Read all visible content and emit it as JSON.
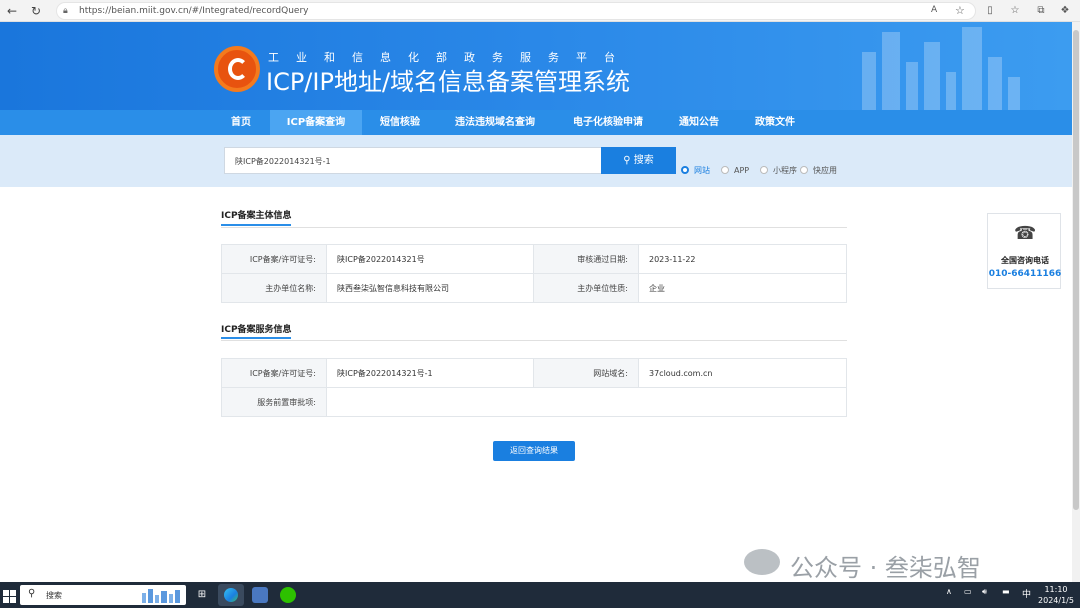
{
  "browser": {
    "url": "https://beian.miit.gov.cn/#/Integrated/recordQuery"
  },
  "header": {
    "gov_title": "工业和信息化部政务服务平台",
    "system_title": "ICP/IP地址/域名信息备案管理系统"
  },
  "nav": {
    "items": [
      "首页",
      "ICP备案查询",
      "短信核验",
      "违法违规域名查询",
      "电子化核验申请",
      "通知公告",
      "政策文件"
    ],
    "active_index": 1
  },
  "search": {
    "value": "陕ICP备2022014321号-1",
    "button_label": "搜索",
    "types": [
      "网站",
      "APP",
      "小程序",
      "快应用"
    ],
    "selected_type": "网站"
  },
  "subject_section": {
    "title": "ICP备案主体信息",
    "rows": [
      {
        "label1": "ICP备案/许可证号:",
        "value1": "陕ICP备2022014321号",
        "label2": "审核通过日期:",
        "value2": "2023-11-22"
      },
      {
        "label1": "主办单位名称:",
        "value1": "陕西叁柒弘智信息科技有限公司",
        "label2": "主办单位性质:",
        "value2": "企业"
      }
    ]
  },
  "service_section": {
    "title": "ICP备案服务信息",
    "row1": {
      "label1": "ICP备案/许可证号:",
      "value1": "陕ICP备2022014321号-1",
      "label2": "网站域名:",
      "value2": "37cloud.com.cn"
    },
    "row2": {
      "label1": "服务前置审批项:",
      "value1": ""
    }
  },
  "back_button": "返回查询结果",
  "side_widget": {
    "icon": "phone-icon",
    "label": "全国咨询电话",
    "phone": "010-66411166"
  },
  "watermark": "公众号 · 叁柒弘智",
  "taskbar": {
    "search_label": "搜索",
    "ime": "中",
    "time": "11:10",
    "date": "2024/1/5"
  },
  "colors": {
    "primary": "#1a7fe0",
    "nav": "#2a8ee8",
    "search_band": "#dbeaf9"
  }
}
